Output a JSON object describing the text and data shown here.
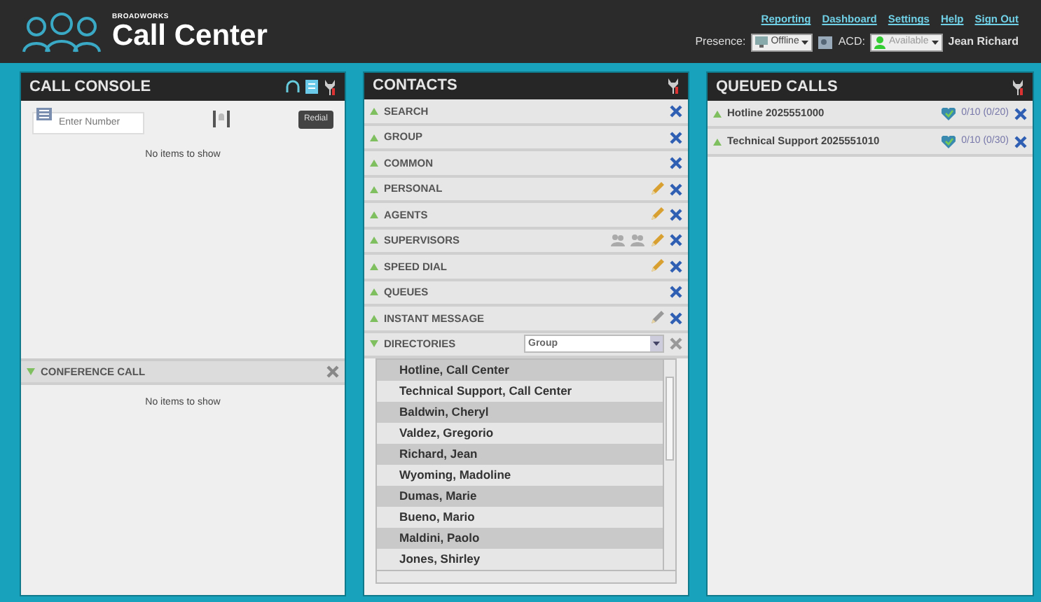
{
  "header": {
    "brand_small": "BROADWORKS",
    "brand": "Call Center",
    "links": [
      "Reporting",
      "Dashboard",
      "Settings",
      "Help",
      "Sign Out"
    ],
    "presence_label": "Presence:",
    "presence_value": "Offline",
    "acd_label": "ACD:",
    "acd_value": "Available",
    "user": "Jean Richard"
  },
  "call_console": {
    "title": "CALL CONSOLE",
    "number_placeholder": "Enter Number",
    "redial": "Redial",
    "empty": "No items to show",
    "conference": {
      "title": "CONFERENCE CALL",
      "expanded": true,
      "empty": "No items to show"
    }
  },
  "contacts": {
    "title": "CONTACTS",
    "sections": [
      {
        "label": "SEARCH",
        "kind": "plain",
        "expanded": false
      },
      {
        "label": "GROUP",
        "kind": "plain",
        "expanded": false
      },
      {
        "label": "COMMON",
        "kind": "plain",
        "expanded": false
      },
      {
        "label": "PERSONAL",
        "kind": "editable",
        "expanded": false
      },
      {
        "label": "AGENTS",
        "kind": "editable",
        "expanded": false
      },
      {
        "label": "SUPERVISORS",
        "kind": "supervisors",
        "expanded": false
      },
      {
        "label": "SPEED DIAL",
        "kind": "editable",
        "expanded": false
      },
      {
        "label": "QUEUES",
        "kind": "plain",
        "expanded": false
      },
      {
        "label": "INSTANT MESSAGE",
        "kind": "message",
        "expanded": false
      },
      {
        "label": "DIRECTORIES",
        "kind": "directory",
        "expanded": true,
        "filter": "Group",
        "entries": [
          "Hotline, Call Center",
          "Technical Support, Call Center",
          "Baldwin, Cheryl",
          "Valdez, Gregorio",
          "Richard, Jean",
          "Wyoming, Madoline",
          "Dumas, Marie",
          "Bueno, Mario",
          "Maldini, Paolo",
          "Jones, Shirley"
        ]
      }
    ]
  },
  "queued_calls": {
    "title": "QUEUED CALLS",
    "queues": [
      {
        "label": "Hotline 2025551000",
        "stats": "0/10 (0/20)",
        "expanded": false
      },
      {
        "label": "Technical Support 2025551010",
        "stats": "0/10 (0/30)",
        "expanded": false
      }
    ]
  }
}
